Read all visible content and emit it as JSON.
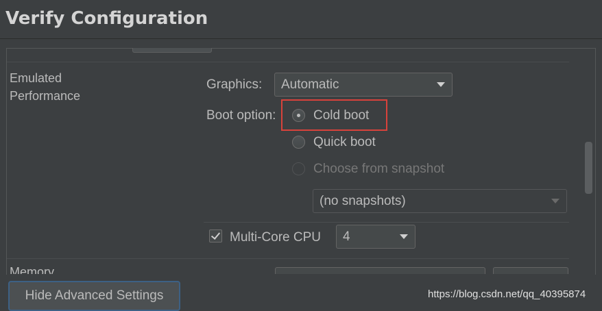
{
  "dialog": {
    "title": "Verify Configuration"
  },
  "section": {
    "label": "Emulated\nPerformance",
    "label_line1": "Emulated",
    "label_line2": "Performance"
  },
  "graphics": {
    "label": "Graphics:",
    "value": "Automatic"
  },
  "boot": {
    "label": "Boot option:",
    "options": [
      {
        "label": "Cold boot",
        "selected": true,
        "enabled": true
      },
      {
        "label": "Quick boot",
        "selected": false,
        "enabled": true
      },
      {
        "label": "Choose from snapshot",
        "selected": false,
        "enabled": false
      }
    ],
    "snapshot_value": "(no snapshots)"
  },
  "multicore": {
    "label": "Multi-Core CPU",
    "checked": true,
    "value": "4"
  },
  "next_section": {
    "label": "Memory"
  },
  "footer": {
    "hide_button": "Hide Advanced Settings",
    "watermark": "https://blog.csdn.net/qq_40395874"
  },
  "colors": {
    "background": "#3c3f41",
    "highlight": "#d9423b",
    "focus_border": "#3d6185"
  }
}
